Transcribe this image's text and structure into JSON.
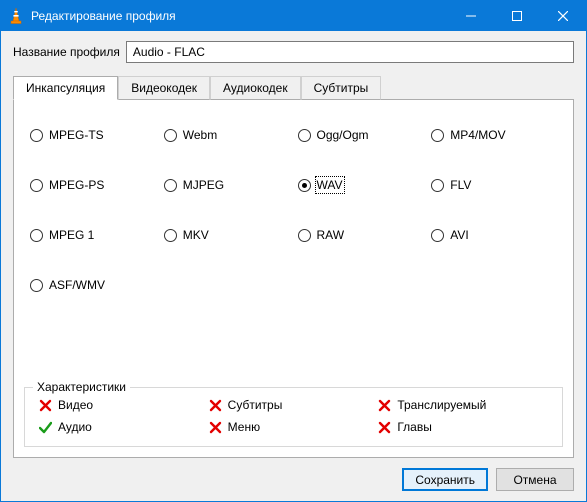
{
  "window": {
    "title": "Редактирование профиля"
  },
  "profile": {
    "label": "Название профиля",
    "value": "Audio - FLAC"
  },
  "tabs": [
    {
      "label": "Инкапсуляция",
      "active": true
    },
    {
      "label": "Видеокодек",
      "active": false
    },
    {
      "label": "Аудиокодек",
      "active": false
    },
    {
      "label": "Субтитры",
      "active": false
    }
  ],
  "formats": {
    "selected": "WAV",
    "items": [
      "MPEG-TS",
      "Webm",
      "Ogg/Ogm",
      "MP4/MOV",
      "MPEG-PS",
      "MJPEG",
      "WAV",
      "FLV",
      "MPEG 1",
      "MKV",
      "RAW",
      "AVI",
      "ASF/WMV"
    ]
  },
  "features": {
    "legend": "Характеристики",
    "items": [
      {
        "label": "Видео",
        "ok": false
      },
      {
        "label": "Субтитры",
        "ok": false
      },
      {
        "label": "Транслируемый",
        "ok": false
      },
      {
        "label": "Аудио",
        "ok": true
      },
      {
        "label": "Меню",
        "ok": false
      },
      {
        "label": "Главы",
        "ok": false
      }
    ]
  },
  "buttons": {
    "save": "Сохранить",
    "cancel": "Отмена"
  }
}
